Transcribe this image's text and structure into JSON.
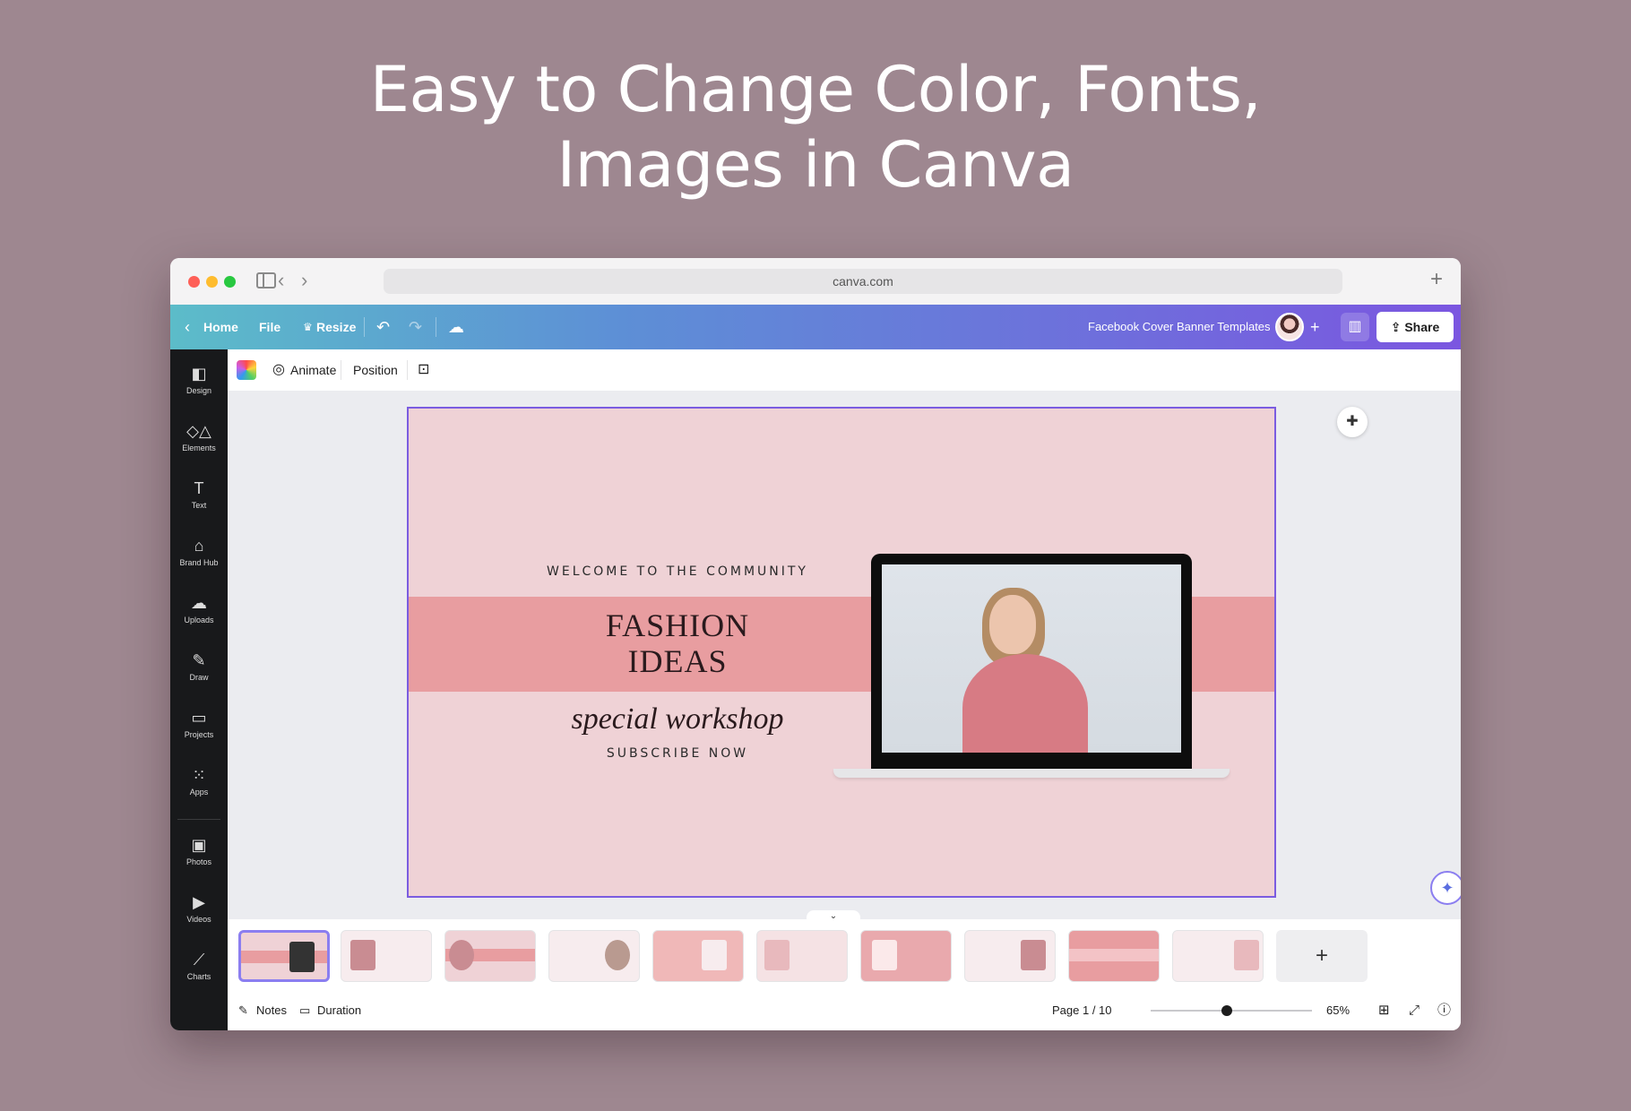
{
  "headline": {
    "line1": "Easy to Change Color, Fonts,",
    "line2": "Images in Canva"
  },
  "browser": {
    "url": "canva.com"
  },
  "topbar": {
    "home_label": "Home",
    "file_label": "File",
    "resize_label": "Resize",
    "doc_title": "Facebook Cover Banner Templates",
    "share_label": "Share"
  },
  "sidebar": {
    "items": [
      {
        "label": "Design",
        "icon": "design-icon"
      },
      {
        "label": "Elements",
        "icon": "elements-icon"
      },
      {
        "label": "Text",
        "icon": "text-icon"
      },
      {
        "label": "Brand Hub",
        "icon": "brand-hub-icon"
      },
      {
        "label": "Uploads",
        "icon": "uploads-icon"
      },
      {
        "label": "Draw",
        "icon": "draw-icon"
      },
      {
        "label": "Projects",
        "icon": "projects-icon"
      },
      {
        "label": "Apps",
        "icon": "apps-icon"
      },
      {
        "label": "Photos",
        "icon": "photos-icon"
      },
      {
        "label": "Videos",
        "icon": "videos-icon"
      },
      {
        "label": "Charts",
        "icon": "charts-icon"
      }
    ]
  },
  "toolbar": {
    "animate_label": "Animate",
    "position_label": "Position"
  },
  "design": {
    "welcome": "WELCOME TO THE COMMUNITY",
    "fashion_line1": "FASHION",
    "fashion_line2": "IDEAS",
    "special": "special workshop",
    "subscribe": "SUBSCRIBE NOW",
    "colors": {
      "background": "#efd2d6",
      "band": "#e89da0",
      "selection": "#7b5ce0"
    }
  },
  "pages": {
    "count": 10,
    "selected": 1
  },
  "footer": {
    "notes_label": "Notes",
    "duration_label": "Duration",
    "page_indicator": "Page 1 / 10",
    "zoom": "65%"
  }
}
